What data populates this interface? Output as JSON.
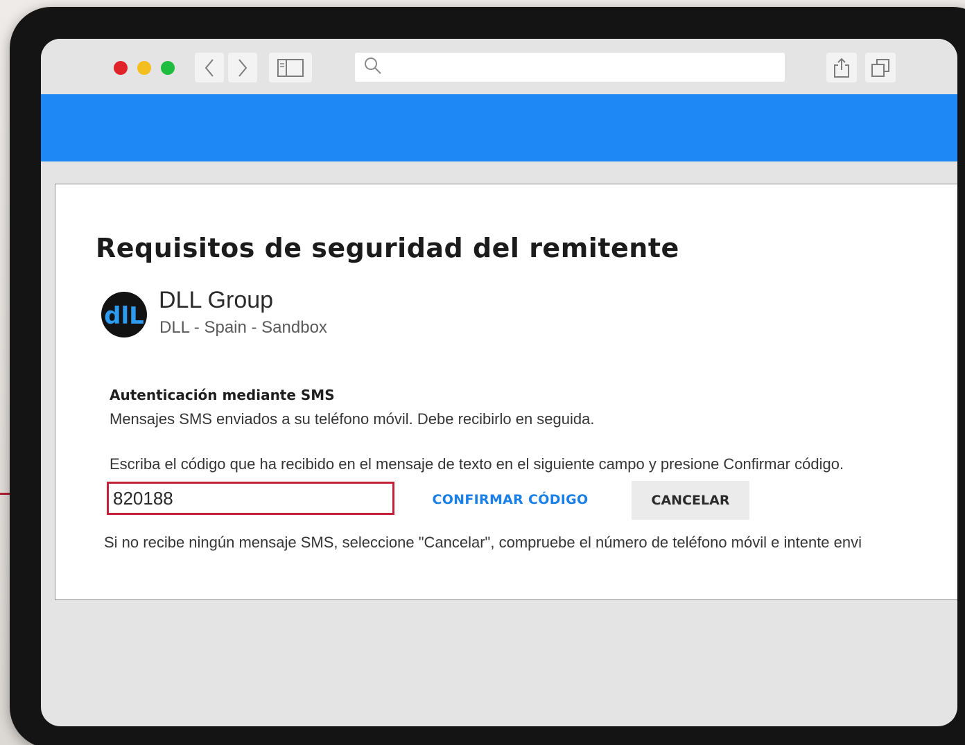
{
  "colors": {
    "accent_blue": "#1e88f5",
    "highlight_red": "#c3203a",
    "traffic_red": "#e0222b",
    "traffic_yellow": "#f4be1f",
    "traffic_green": "#1fbd3f"
  },
  "browser": {
    "icons": [
      "back-icon",
      "forward-icon",
      "sidebar-icon",
      "search-icon",
      "share-icon",
      "tabs-icon"
    ],
    "address_value": ""
  },
  "page": {
    "title": "Requisitos de seguridad del remitente",
    "org_name": "DLL Group",
    "org_subtitle": "DLL - Spain - Sandbox",
    "logo_text": "dlL",
    "auth_title": "Autenticación mediante SMS",
    "auth_description": "Mensajes SMS enviados a su teléfono móvil. Debe recibirlo en seguida.",
    "instructions": "Escriba el código que ha recibido en el mensaje de texto en el siguiente campo y presione Confirmar código.",
    "code_value": "820188",
    "confirm_label": "CONFIRMAR CÓDIGO",
    "cancel_label": "CANCELAR",
    "help_text": "Si no recibe ningún mensaje SMS, seleccione \"Cancelar\", compruebe el número de teléfono móvil e intente envi"
  }
}
